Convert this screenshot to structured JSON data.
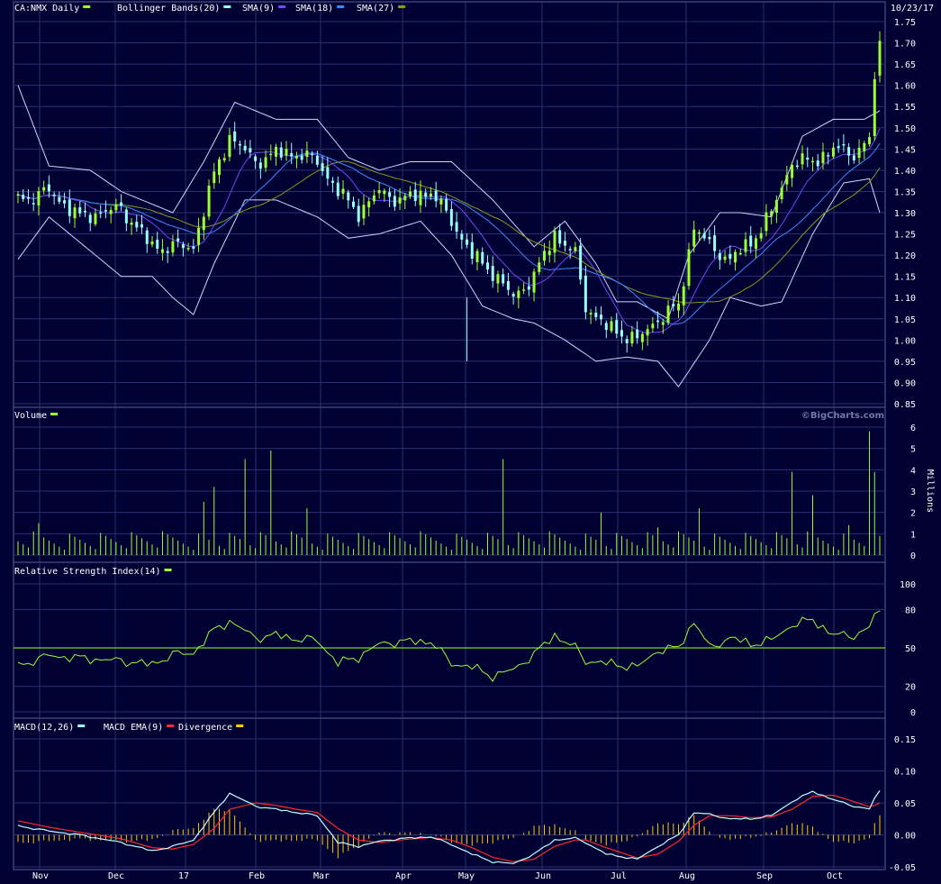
{
  "date_label": "10/23/17",
  "credit": "©BigCharts.com",
  "colors": {
    "background": "#000033",
    "grid": "#2c2f72",
    "candle_up": "#99ff33",
    "candle_down": "#99ffff",
    "bollinger": "#cfd6ff",
    "sma9": "#7744ff",
    "sma18": "#3a8bff",
    "sma27": "#8a9a1a",
    "volume": "#99ff33",
    "rsi": "#99ff33",
    "macd": "#c0ffff",
    "macd_ema": "#ff2a2a",
    "divergence": "#ffcc00"
  },
  "legends": {
    "price": [
      {
        "text": "CA:NMX Daily",
        "color": "#99ff33"
      },
      {
        "text": "Bollinger Bands(20)",
        "color": "#99ffff"
      },
      {
        "text": "SMA(9)",
        "color": "#7744ff"
      },
      {
        "text": "SMA(18)",
        "color": "#3a8bff"
      },
      {
        "text": "SMA(27)",
        "color": "#8a9a1a"
      }
    ],
    "volume": [
      {
        "text": "Volume",
        "color": "#99ff33"
      }
    ],
    "rsi": [
      {
        "text": "Relative Strength Index(14)",
        "color": "#99ff33"
      }
    ],
    "macd": [
      {
        "text": "MACD(12,26)",
        "color": "#99ffff"
      },
      {
        "text": "MACD EMA(9)",
        "color": "#ff2a2a"
      },
      {
        "text": "Divergence",
        "color": "#ffcc00"
      }
    ]
  },
  "x_labels": [
    "Nov",
    "Dec",
    "17",
    "Feb",
    "Mar",
    "Apr",
    "May",
    "Jun",
    "Jul",
    "Aug",
    "Sep",
    "Oct"
  ],
  "chart_data": [
    {
      "type": "candlestick",
      "name": "price",
      "ylim": [
        0.85,
        1.75
      ],
      "yticks": [
        "0.85",
        "0.90",
        "0.95",
        "1.00",
        "1.05",
        "1.10",
        "1.15",
        "1.20",
        "1.25",
        "1.30",
        "1.35",
        "1.40",
        "1.45",
        "1.50",
        "1.55",
        "1.60",
        "1.65",
        "1.70",
        "1.75"
      ],
      "anchors": [
        [
          0,
          1.33
        ],
        [
          6,
          1.35
        ],
        [
          12,
          1.29
        ],
        [
          20,
          1.31
        ],
        [
          26,
          1.22
        ],
        [
          30,
          1.22
        ],
        [
          34,
          1.22
        ],
        [
          38,
          1.39
        ],
        [
          41,
          1.48
        ],
        [
          46,
          1.42
        ],
        [
          50,
          1.44
        ],
        [
          54,
          1.44
        ],
        [
          58,
          1.42
        ],
        [
          62,
          1.35
        ],
        [
          66,
          1.3
        ],
        [
          70,
          1.35
        ],
        [
          74,
          1.33
        ],
        [
          80,
          1.35
        ],
        [
          84,
          1.28
        ],
        [
          88,
          1.2
        ],
        [
          92,
          1.16
        ],
        [
          96,
          1.1
        ],
        [
          100,
          1.15
        ],
        [
          104,
          1.25
        ],
        [
          108,
          1.2
        ],
        [
          110,
          1.08
        ],
        [
          114,
          1.03
        ],
        [
          120,
          1.0
        ],
        [
          124,
          1.05
        ],
        [
          128,
          1.08
        ],
        [
          131,
          1.27
        ],
        [
          134,
          1.22
        ],
        [
          138,
          1.19
        ],
        [
          142,
          1.23
        ],
        [
          146,
          1.3
        ],
        [
          150,
          1.42
        ],
        [
          154,
          1.42
        ],
        [
          158,
          1.45
        ],
        [
          162,
          1.44
        ],
        [
          165,
          1.47
        ],
        [
          166,
          1.62
        ],
        [
          167,
          1.69
        ]
      ],
      "bollinger_upper": [
        [
          0,
          1.6
        ],
        [
          6,
          1.41
        ],
        [
          14,
          1.4
        ],
        [
          20,
          1.35
        ],
        [
          30,
          1.3
        ],
        [
          36,
          1.42
        ],
        [
          42,
          1.56
        ],
        [
          50,
          1.52
        ],
        [
          58,
          1.52
        ],
        [
          64,
          1.43
        ],
        [
          70,
          1.4
        ],
        [
          76,
          1.42
        ],
        [
          84,
          1.42
        ],
        [
          92,
          1.33
        ],
        [
          100,
          1.22
        ],
        [
          106,
          1.28
        ],
        [
          112,
          1.18
        ],
        [
          116,
          1.09
        ],
        [
          120,
          1.09
        ],
        [
          126,
          1.05
        ],
        [
          130,
          1.2
        ],
        [
          136,
          1.3
        ],
        [
          140,
          1.3
        ],
        [
          146,
          1.29
        ],
        [
          152,
          1.48
        ],
        [
          158,
          1.52
        ],
        [
          164,
          1.52
        ],
        [
          167,
          1.54
        ]
      ],
      "bollinger_lower": [
        [
          0,
          1.19
        ],
        [
          6,
          1.29
        ],
        [
          14,
          1.21
        ],
        [
          20,
          1.15
        ],
        [
          26,
          1.15
        ],
        [
          30,
          1.1
        ],
        [
          34,
          1.06
        ],
        [
          38,
          1.18
        ],
        [
          44,
          1.33
        ],
        [
          50,
          1.33
        ],
        [
          58,
          1.29
        ],
        [
          64,
          1.24
        ],
        [
          70,
          1.25
        ],
        [
          78,
          1.28
        ],
        [
          84,
          1.2
        ],
        [
          90,
          1.08
        ],
        [
          96,
          1.05
        ],
        [
          100,
          1.04
        ],
        [
          106,
          1.0
        ],
        [
          112,
          0.95
        ],
        [
          118,
          0.96
        ],
        [
          124,
          0.95
        ],
        [
          128,
          0.89
        ],
        [
          134,
          1.0
        ],
        [
          138,
          1.1
        ],
        [
          144,
          1.08
        ],
        [
          148,
          1.09
        ],
        [
          154,
          1.25
        ],
        [
          160,
          1.37
        ],
        [
          165,
          1.38
        ],
        [
          167,
          1.3
        ]
      ]
    },
    {
      "type": "bar",
      "name": "volume",
      "ylabel": "Millions",
      "ylim": [
        0,
        6
      ],
      "yticks": [
        "0",
        "1",
        "2",
        "3",
        "4",
        "5",
        "6"
      ],
      "spikes": [
        [
          4,
          1.5
        ],
        [
          36,
          2.5
        ],
        [
          38,
          3.2
        ],
        [
          44,
          4.5
        ],
        [
          49,
          4.9
        ],
        [
          56,
          2.2
        ],
        [
          94,
          4.5
        ],
        [
          113,
          2.0
        ],
        [
          124,
          1.3
        ],
        [
          132,
          2.2
        ],
        [
          150,
          3.9
        ],
        [
          154,
          2.8
        ],
        [
          161,
          1.4
        ],
        [
          165,
          5.8
        ],
        [
          166,
          3.9
        ]
      ]
    },
    {
      "type": "line",
      "name": "rsi",
      "ylim": [
        0,
        100
      ],
      "yticks": [
        "0",
        "20",
        "50",
        "80",
        "100"
      ],
      "reference_line": 50,
      "anchors": [
        [
          0,
          36
        ],
        [
          6,
          44
        ],
        [
          12,
          42
        ],
        [
          20,
          40
        ],
        [
          26,
          37
        ],
        [
          30,
          45
        ],
        [
          34,
          46
        ],
        [
          38,
          64
        ],
        [
          41,
          71
        ],
        [
          46,
          58
        ],
        [
          50,
          60
        ],
        [
          54,
          57
        ],
        [
          58,
          56
        ],
        [
          62,
          38
        ],
        [
          66,
          43
        ],
        [
          70,
          53
        ],
        [
          74,
          55
        ],
        [
          80,
          55
        ],
        [
          84,
          38
        ],
        [
          88,
          35
        ],
        [
          92,
          28
        ],
        [
          96,
          33
        ],
        [
          100,
          45
        ],
        [
          104,
          60
        ],
        [
          108,
          50
        ],
        [
          110,
          40
        ],
        [
          114,
          38
        ],
        [
          120,
          35
        ],
        [
          124,
          48
        ],
        [
          128,
          50
        ],
        [
          131,
          71
        ],
        [
          134,
          50
        ],
        [
          138,
          58
        ],
        [
          142,
          53
        ],
        [
          146,
          56
        ],
        [
          150,
          68
        ],
        [
          154,
          72
        ],
        [
          158,
          60
        ],
        [
          162,
          60
        ],
        [
          165,
          65
        ],
        [
          166,
          78
        ],
        [
          167,
          76
        ]
      ]
    },
    {
      "type": "line",
      "name": "macd",
      "ylim": [
        -0.05,
        0.15
      ],
      "yticks": [
        "-0.05",
        "0.00",
        "0.05",
        "0.10",
        "0.15"
      ],
      "macd_anchors": [
        [
          0,
          0.014
        ],
        [
          6,
          0.006
        ],
        [
          12,
          0.0
        ],
        [
          20,
          -0.012
        ],
        [
          26,
          -0.025
        ],
        [
          30,
          -0.018
        ],
        [
          34,
          -0.008
        ],
        [
          38,
          0.035
        ],
        [
          41,
          0.065
        ],
        [
          46,
          0.045
        ],
        [
          50,
          0.04
        ],
        [
          54,
          0.035
        ],
        [
          58,
          0.03
        ],
        [
          62,
          -0.012
        ],
        [
          66,
          -0.018
        ],
        [
          70,
          -0.01
        ],
        [
          74,
          -0.006
        ],
        [
          80,
          -0.003
        ],
        [
          84,
          -0.015
        ],
        [
          88,
          -0.03
        ],
        [
          92,
          -0.042
        ],
        [
          96,
          -0.045
        ],
        [
          100,
          -0.03
        ],
        [
          104,
          -0.008
        ],
        [
          108,
          -0.005
        ],
        [
          110,
          -0.012
        ],
        [
          114,
          -0.03
        ],
        [
          120,
          -0.038
        ],
        [
          124,
          -0.018
        ],
        [
          128,
          0.0
        ],
        [
          131,
          0.035
        ],
        [
          134,
          0.032
        ],
        [
          138,
          0.025
        ],
        [
          142,
          0.025
        ],
        [
          146,
          0.03
        ],
        [
          150,
          0.052
        ],
        [
          154,
          0.068
        ],
        [
          158,
          0.055
        ],
        [
          162,
          0.045
        ],
        [
          165,
          0.04
        ],
        [
          166,
          0.058
        ],
        [
          167,
          0.068
        ]
      ],
      "ema_anchors": [
        [
          0,
          0.022
        ],
        [
          6,
          0.012
        ],
        [
          12,
          0.004
        ],
        [
          20,
          -0.006
        ],
        [
          26,
          -0.02
        ],
        [
          30,
          -0.022
        ],
        [
          34,
          -0.015
        ],
        [
          38,
          0.01
        ],
        [
          41,
          0.04
        ],
        [
          46,
          0.05
        ],
        [
          50,
          0.046
        ],
        [
          54,
          0.04
        ],
        [
          58,
          0.035
        ],
        [
          62,
          0.01
        ],
        [
          66,
          -0.008
        ],
        [
          70,
          -0.012
        ],
        [
          74,
          -0.008
        ],
        [
          80,
          -0.004
        ],
        [
          84,
          -0.008
        ],
        [
          88,
          -0.02
        ],
        [
          92,
          -0.035
        ],
        [
          96,
          -0.042
        ],
        [
          100,
          -0.038
        ],
        [
          104,
          -0.018
        ],
        [
          108,
          -0.008
        ],
        [
          110,
          -0.008
        ],
        [
          114,
          -0.02
        ],
        [
          120,
          -0.036
        ],
        [
          124,
          -0.03
        ],
        [
          128,
          -0.01
        ],
        [
          131,
          0.015
        ],
        [
          134,
          0.03
        ],
        [
          138,
          0.03
        ],
        [
          142,
          0.027
        ],
        [
          146,
          0.028
        ],
        [
          150,
          0.04
        ],
        [
          154,
          0.06
        ],
        [
          158,
          0.062
        ],
        [
          162,
          0.052
        ],
        [
          165,
          0.044
        ],
        [
          166,
          0.046
        ],
        [
          167,
          0.05
        ]
      ]
    }
  ]
}
